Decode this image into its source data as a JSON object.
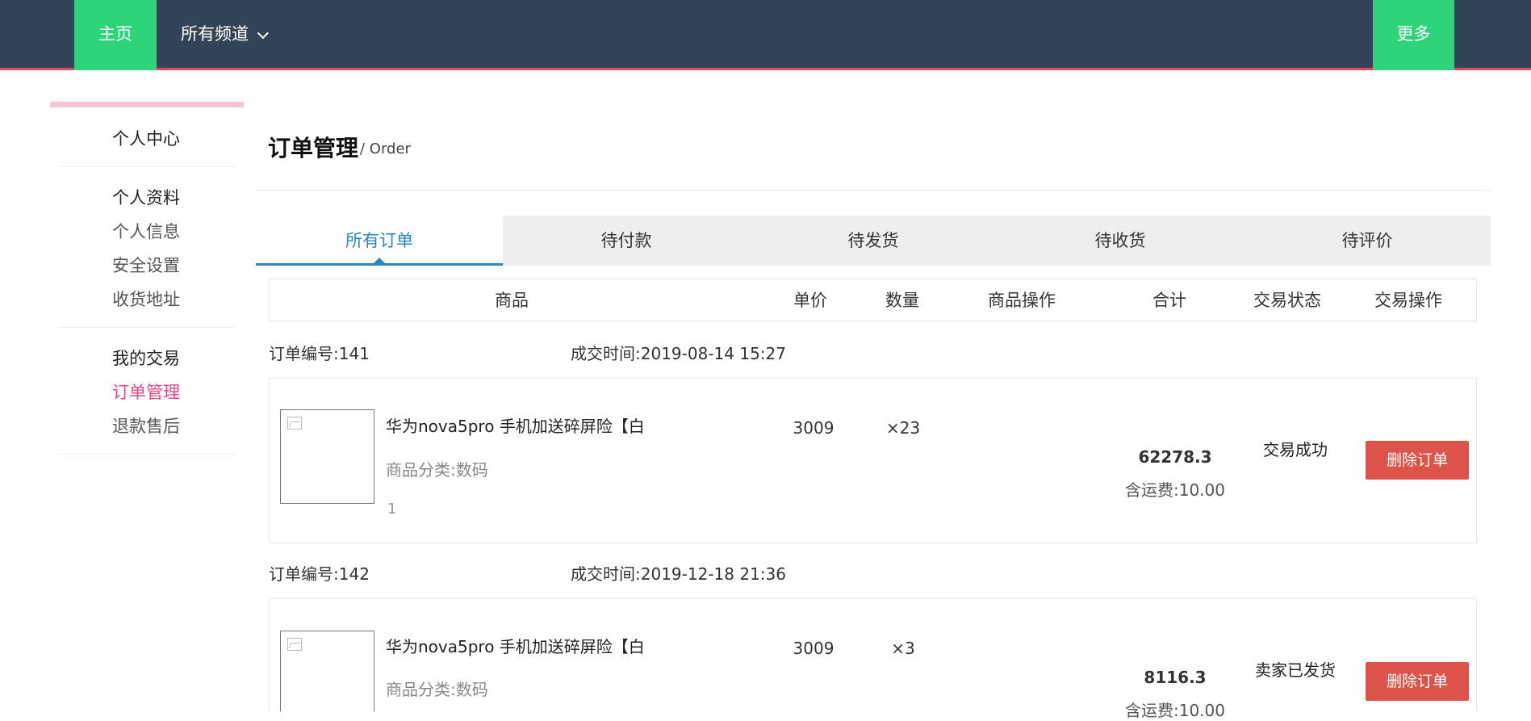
{
  "nav": {
    "home": "主页",
    "channels": "所有频道",
    "more": "更多"
  },
  "sidebar": {
    "center": "个人中心",
    "profile_head": "个人资料",
    "profile_items": [
      "个人信息",
      "安全设置",
      "收货地址"
    ],
    "trade_head": "我的交易",
    "trade_items": [
      "订单管理",
      "退款售后"
    ]
  },
  "page": {
    "title": "订单管理",
    "subtitle": "/ Order"
  },
  "tabs": [
    "所有订单",
    "待付款",
    "待发货",
    "待收货",
    "待评价"
  ],
  "table_headers": [
    "商品",
    "单价",
    "数量",
    "商品操作",
    "合计",
    "交易状态",
    "交易操作"
  ],
  "orders": [
    {
      "number_label": "订单编号:",
      "number": "141",
      "time_label": "成交时间:",
      "time": "2019-08-14 15:27",
      "product_name": "华为nova5pro 手机加送碎屏险【白",
      "category": "商品分类:数码",
      "extra": "1",
      "price": "3009",
      "qty": "×23",
      "total": "62278.3",
      "shipping": "含运费:10.00",
      "status": "交易成功",
      "action": "删除订单"
    },
    {
      "number_label": "订单编号:",
      "number": "142",
      "time_label": "成交时间:",
      "time": "2019-12-18 21:36",
      "product_name": "华为nova5pro 手机加送碎屏险【白",
      "category": "商品分类:数码",
      "price": "3009",
      "qty": "×3",
      "total": "8116.3",
      "shipping": "含运费:10.00",
      "status": "卖家已发货",
      "action": "删除订单"
    }
  ],
  "colors": {
    "nav_bg": "#334456",
    "nav_accent": "#2ed47a",
    "nav_border": "#e0475e",
    "tab_active": "#2b86c5",
    "sidebar_active": "#e8478c",
    "delete_button": "#dd5349"
  }
}
